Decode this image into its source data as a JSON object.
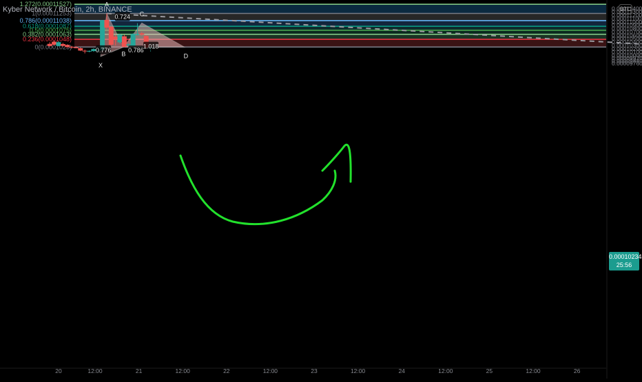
{
  "header": {
    "title": "Kyber Network / Bitcoin, 2h, BINANCE",
    "currency_badge": "BTC"
  },
  "price_tag": {
    "price": "0.00010234",
    "countdown": "25:56"
  },
  "colors": {
    "bull": "#26a69a",
    "bear": "#ef5350",
    "drawing": "#22e12c",
    "axis_text": "#888a91",
    "price_tag_bg": "#1b9c8f"
  },
  "chart_data": {
    "type": "candlestick",
    "title": "Kyber Network / Bitcoin, 2h, BINANCE",
    "ylim": [
      9.7e-06,
      0.0001151
    ],
    "y_ticks": [
      "0.00011400",
      "0.00011300",
      "0.00011200",
      "0.00011100",
      "0.00011000",
      "0.00010900",
      "0.00010800",
      "0.00010700",
      "0.00010600",
      "0.00010500",
      "0.00010400",
      "0.00010300",
      "0.00010200",
      "0.00010100",
      "0.00010000",
      "0.00009920",
      "0.00009840",
      "0.00009760"
    ],
    "x_ticks": [
      "20",
      "12:00",
      "21",
      "12:00",
      "22",
      "12:00",
      "23",
      "12:00",
      "24",
      "12:00",
      "25",
      "12:00",
      "26",
      "12:00"
    ],
    "x_tick_index": [
      0,
      10,
      22,
      34,
      46,
      58,
      70,
      82,
      94,
      106,
      118,
      130,
      142,
      154
    ],
    "candles": [
      {
        "i": -2.4,
        "o": 0.00010345,
        "h": 0.00010395,
        "l": 0.00010265,
        "c": 0.0001028
      },
      {
        "i": -1.2,
        "o": 0.0001041,
        "h": 0.00010445,
        "l": 0.00010295,
        "c": 0.0001032
      },
      {
        "i": 0,
        "o": 0.0001028,
        "h": 0.0001042,
        "l": 0.0001027,
        "c": 0.00010395
      },
      {
        "i": 1.2,
        "o": 0.0001034,
        "h": 0.00010375,
        "l": 0.0001026,
        "c": 0.00010285
      },
      {
        "i": 2.4,
        "o": 0.0001031,
        "h": 0.0001033,
        "l": 0.00010225,
        "c": 0.0001025
      },
      {
        "i": 3.6,
        "o": 0.0001026,
        "h": 0.00010285,
        "l": 0.00010205,
        "c": 0.00010235
      },
      {
        "i": 4.8,
        "o": 0.0001024,
        "h": 0.0001027,
        "l": 0.0001021,
        "c": 0.00010215
      },
      {
        "i": 6,
        "o": 0.00010215,
        "h": 0.00010235,
        "l": 0.0001013,
        "c": 0.00010145
      },
      {
        "i": 7.2,
        "o": 0.0001014,
        "h": 0.00010175,
        "l": 0.0001006,
        "c": 0.00010125
      },
      {
        "i": 8.4,
        "o": 0.00010125,
        "h": 0.0001015,
        "l": 0.00010095,
        "c": 0.00010135
      },
      {
        "i": 9.6,
        "o": 0.0001013,
        "h": 0.0001021,
        "l": 0.0001011,
        "c": 0.0001019
      },
      {
        "i": 10.8,
        "o": 0.0001015,
        "h": 0.00010185,
        "l": 0.0001009,
        "c": 0.0001016
      },
      {
        "i": 12,
        "o": 0.0001015,
        "h": 0.0001104,
        "l": 0.0001014,
        "c": 0.0001105
      },
      {
        "i": 13.2,
        "o": 0.0001106,
        "h": 0.00011253,
        "l": 0.0001078,
        "c": 0.0001083
      },
      {
        "i": 14.4,
        "o": 0.0001086,
        "h": 0.0001087,
        "l": 0.000103,
        "c": 0.0001032
      },
      {
        "i": 15.6,
        "o": 0.0001056,
        "h": 0.0001061,
        "l": 0.000103,
        "c": 0.0001048
      },
      {
        "i": 16.8,
        "o": 0.0001039,
        "h": 0.0001065,
        "l": 0.0001035,
        "c": 0.0001062
      },
      {
        "i": 18,
        "o": 0.0001057,
        "h": 0.0001062,
        "l": 0.0001024,
        "c": 0.00010255
      },
      {
        "i": 19.2,
        "o": 0.000103,
        "h": 0.0001036,
        "l": 0.0001024,
        "c": 0.0001033
      },
      {
        "i": 20.4,
        "o": 0.0001028,
        "h": 0.0001066,
        "l": 0.0001025,
        "c": 0.0001064
      },
      {
        "i": 21.6,
        "o": 0.0001061,
        "h": 0.0001096,
        "l": 0.0001059,
        "c": 0.0001064
      },
      {
        "i": 22.8,
        "o": 0.0001066,
        "h": 0.000107,
        "l": 0.0001059,
        "c": 0.0001062
      },
      {
        "i": 24,
        "o": 0.0001058,
        "h": 0.000106,
        "l": 0.0001021,
        "c": 0.0001023
      },
      {
        "i": 25.2,
        "o": 0.0001023,
        "h": 0.0001024,
        "l": 0.0001012,
        "c": 0.00010234
      }
    ],
    "fib_levels": [
      {
        "label": "1.272(0.00011527)",
        "value": 0.00011527,
        "color": "#81c784"
      },
      {
        "label": "1(0.00011253)",
        "value": 0.00011253,
        "color": "#787b86"
      },
      {
        "label": "0.786(0.00011038)",
        "value": 0.00011038,
        "color": "#64b5f6"
      },
      {
        "label": "0.618(0.0001087)",
        "value": 0.0001087,
        "color": "#089981"
      },
      {
        "label": "0.5(0.0001075)",
        "value": 0.0001075,
        "color": "#4caf50"
      },
      {
        "label": "0.382(0.0001063)",
        "value": 0.0001063,
        "color": "#81c784"
      },
      {
        "label": "0.236(0.0001048)",
        "value": 0.0001048,
        "color": "#f23645"
      },
      {
        "label": "0(0.0001025)",
        "value": 0.0001025,
        "color": "#787b86"
      }
    ],
    "fib_zone_colors": [
      "#0b2a40",
      "#272727",
      "#13263c",
      "#0e2b2d",
      "#0c2a20",
      "#1b3324",
      "#3a1314"
    ],
    "pattern": {
      "points": [
        {
          "name": "X",
          "i": 11.5,
          "v": 9.968e-05
        },
        {
          "name": "A",
          "i": 13.2,
          "v": 0.00011253
        },
        {
          "name": "B",
          "i": 17.8,
          "v": 0.0001025
        },
        {
          "name": "C",
          "i": 22.8,
          "v": 0.0001097
        },
        {
          "name": "D",
          "i": 34.5,
          "v": 0.0001025
        }
      ],
      "ratios": [
        {
          "text": "0.724",
          "i": 17.5,
          "v": 0.0001113
        },
        {
          "text": "0.776",
          "i": 12.3,
          "v": 0.00010135
        },
        {
          "text": "0.786",
          "i": 21.2,
          "v": 0.0001013
        },
        {
          "text": "1.018",
          "i": 25.3,
          "v": 0.00010245
        }
      ],
      "label_names": [
        "X",
        "A",
        "B",
        "C",
        "D"
      ]
    },
    "trendline": {
      "from": {
        "i": 13.2,
        "v": 0.00011253
      },
      "to": {
        "i": 174,
        "v": 0.0001025
      }
    }
  }
}
